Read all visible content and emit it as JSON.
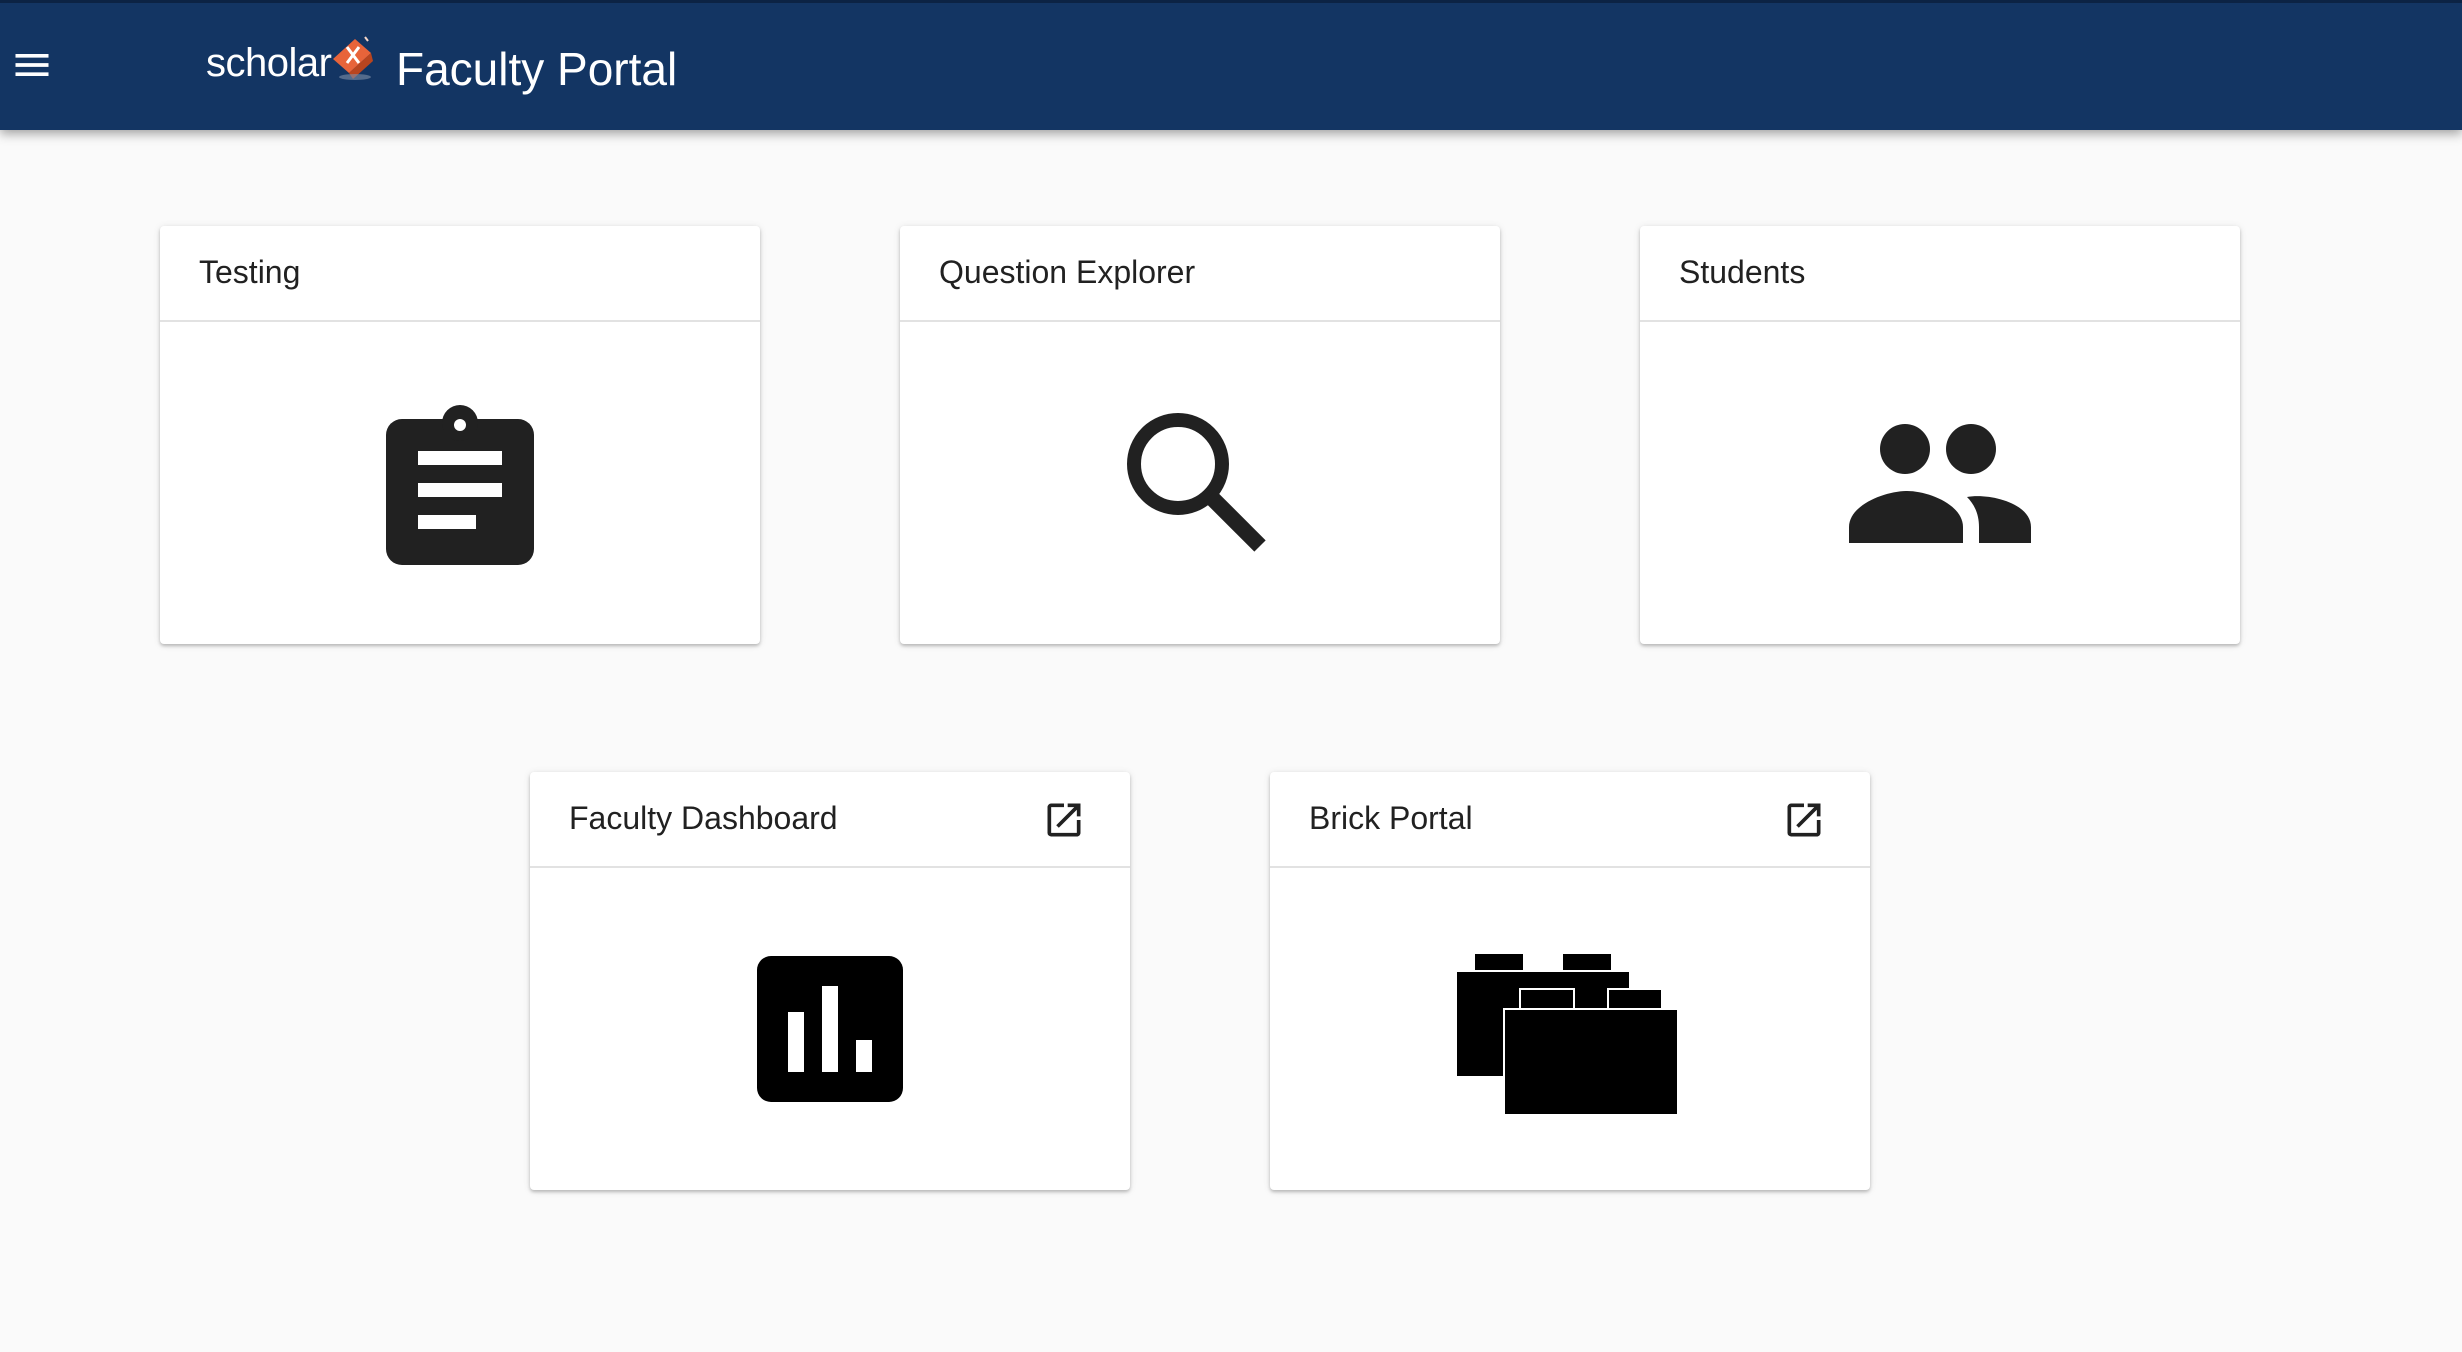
{
  "header": {
    "logo_text": "scholar",
    "title": "Faculty Portal",
    "menu_icon": "hamburger-menu-icon",
    "logo_icon": "scholar-logo-icon"
  },
  "cards": [
    {
      "id": "testing",
      "title": "Testing",
      "icon": "assignment-icon",
      "external": false
    },
    {
      "id": "question-explorer",
      "title": "Question Explorer",
      "icon": "search-icon",
      "external": false
    },
    {
      "id": "students",
      "title": "Students",
      "icon": "people-icon",
      "external": false
    },
    {
      "id": "faculty-dashboard",
      "title": "Faculty Dashboard",
      "icon": "bar-chart-icon",
      "external": true
    },
    {
      "id": "brick-portal",
      "title": "Brick Portal",
      "icon": "bricks-icon",
      "external": true
    }
  ],
  "colors": {
    "header_bg": "#133563",
    "page_bg": "#fafafa",
    "card_bg": "#ffffff",
    "icon": "#212121",
    "logo_accent": "#e8643a"
  }
}
